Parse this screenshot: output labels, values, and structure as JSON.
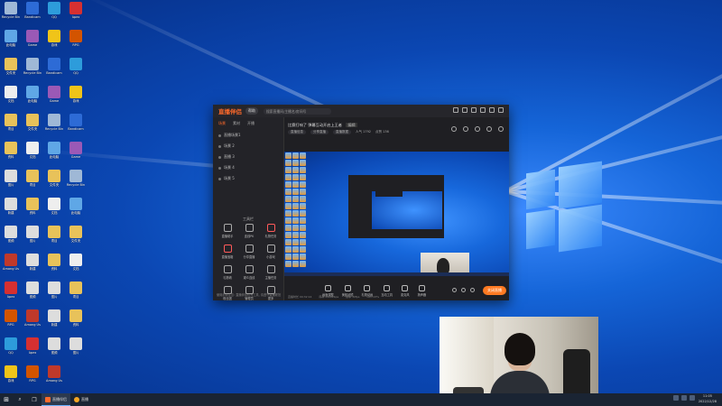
{
  "desktop": {
    "icons": [
      {
        "label": "Recycle Bin",
        "color": "#9fb8d6"
      },
      {
        "label": "此电脑",
        "color": "#5fa7e6"
      },
      {
        "label": "文件夹",
        "color": "#e8c25a"
      },
      {
        "label": "文档",
        "color": "#eeeeee"
      },
      {
        "label": "项目",
        "color": "#e8c25a"
      },
      {
        "label": "资料",
        "color": "#e8c25a"
      },
      {
        "label": "图片",
        "color": "#dddddd"
      },
      {
        "label": "新建",
        "color": "#dddddd"
      },
      {
        "label": "视频",
        "color": "#dddddd"
      },
      {
        "label": "Among Us",
        "color": "#c0392b"
      },
      {
        "label": "Apex",
        "color": "#d63031"
      },
      {
        "label": "RPG",
        "color": "#d35400"
      },
      {
        "label": "QQ",
        "color": "#2d9cdb"
      },
      {
        "label": "游戏",
        "color": "#f0c419"
      },
      {
        "label": "Bandicam",
        "color": "#2d6bd6"
      },
      {
        "label": "Game",
        "color": "#9b59b6"
      }
    ]
  },
  "app": {
    "logo": "直播伴侣",
    "badge": "帮助",
    "search_placeholder": "搜索直播间/主播名/房间号",
    "tabs": [
      "场景",
      "素材",
      "开播"
    ],
    "scenes": [
      "直播场景1",
      "场景 2",
      "直播 3",
      "场景 4",
      "场景 5"
    ],
    "tools_title": "工具栏",
    "tools": [
      "直播助手",
      "连线PK",
      "礼物任务",
      "直播宝箱",
      "分享直播",
      "小游戏",
      "礼物墙",
      "观众连线",
      "主播任务",
      "粉丝团",
      "管理员",
      "更多"
    ],
    "footer": "使用前请注意: 直播伴侣仅为工具, 请遵守直播规范",
    "live_title": "比赛打响了 弹幕互动开启上王者",
    "live_tag": "编辑",
    "meta": [
      "直播信息",
      "分享直播",
      "直播数据",
      "人气 1792",
      "点赞 136"
    ],
    "controls": [
      "画面调整",
      "美颜滤镜",
      "礼物动画",
      "互动工具",
      "麦克风",
      "扬声器"
    ],
    "go_live": "关闭直播",
    "status": [
      "直播时长 00:32:14",
      "码率 2400kbps",
      "帧率 30fps",
      "CPU 23%"
    ]
  },
  "taskbar": {
    "start_icon": "windows-icon",
    "apps": [
      {
        "label": "直播伴侣",
        "color": "#ff6a2b",
        "active": true
      },
      {
        "label": "直播",
        "color": "#f5a623",
        "active": false
      }
    ],
    "clock_time": "11:05",
    "clock_date": "2022/12/28"
  },
  "colors": {
    "accent": "#ff6a2b",
    "wallpaper": "#1565d8",
    "taskbar": "#1a2433"
  }
}
